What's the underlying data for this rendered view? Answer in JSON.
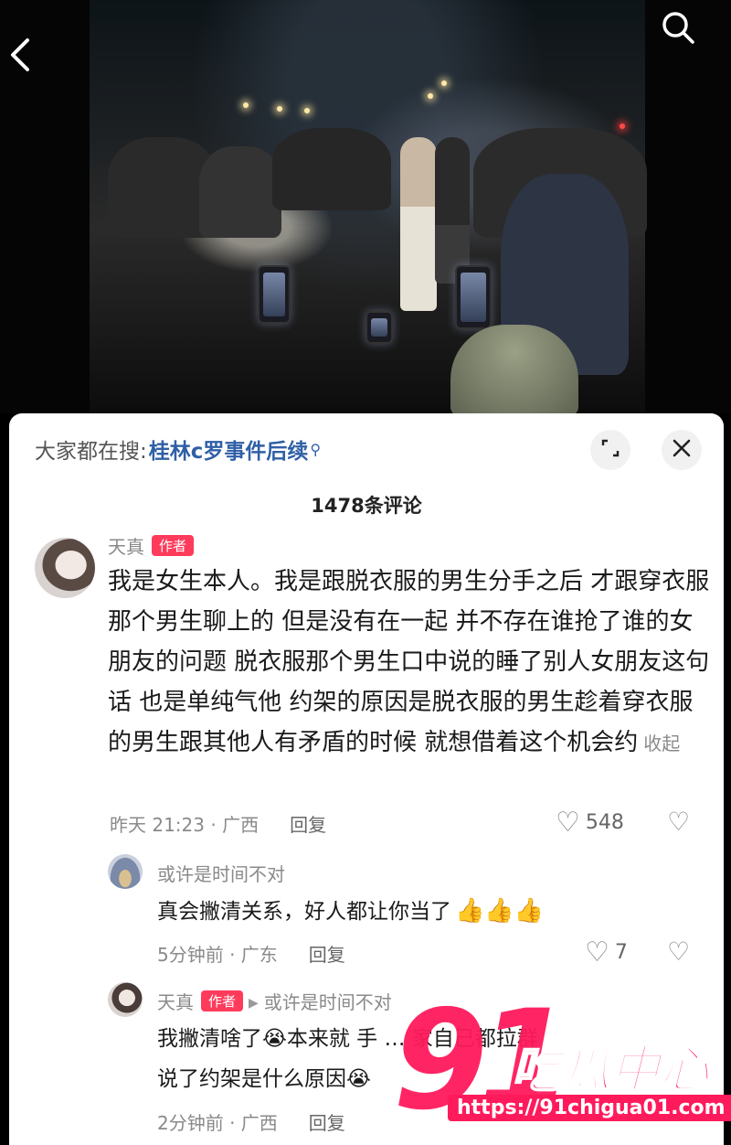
{
  "header": {
    "back_icon": "chevron-left-icon",
    "search_icon": "search-icon"
  },
  "sheet": {
    "search_prefix": "大家都在搜:",
    "search_keyword": "桂林c罗事件后续",
    "comment_count": "1478条评论"
  },
  "comments": [
    {
      "user": "天真",
      "badge": "作者",
      "text": "我是女生本人。我是跟脱衣服的男生分手之后 才跟穿衣服那个男生聊上的 但是没有在一起 并不存在谁抢了谁的女朋友的问题 脱衣服那个男生口中说的睡了别人女朋友这句话 也是单纯气他 约架的原因是脱衣服的男生趁着穿衣服的男生跟其他人有矛盾的时候 就想借着这个机会约",
      "collapse": "收起",
      "time": "昨天 21:23 · 广西",
      "reply": "回复",
      "likes": "548"
    },
    {
      "user": "或许是时间不对",
      "text": "真会撇清关系，好人都让你当了",
      "emojis": "👍👍👍",
      "time": "5分钟前 · 广东",
      "reply": "回复",
      "likes": "7"
    },
    {
      "user": "天真",
      "badge": "作者",
      "reply_to": "或许是时间不对",
      "line1": "我撇清啥了😭本来就 手 … 家自己都拉群",
      "line2": "说了约架是什么原因😭",
      "time": "2分钟前 · 广西",
      "reply": "回复"
    }
  ],
  "watermark": {
    "number": "91",
    "name": "吃瓜中心",
    "url": "https://91chigua01.com"
  },
  "colors": {
    "accent": "#ff1a5c",
    "link": "#2f5fa6",
    "badge": "#ff3b5c"
  }
}
